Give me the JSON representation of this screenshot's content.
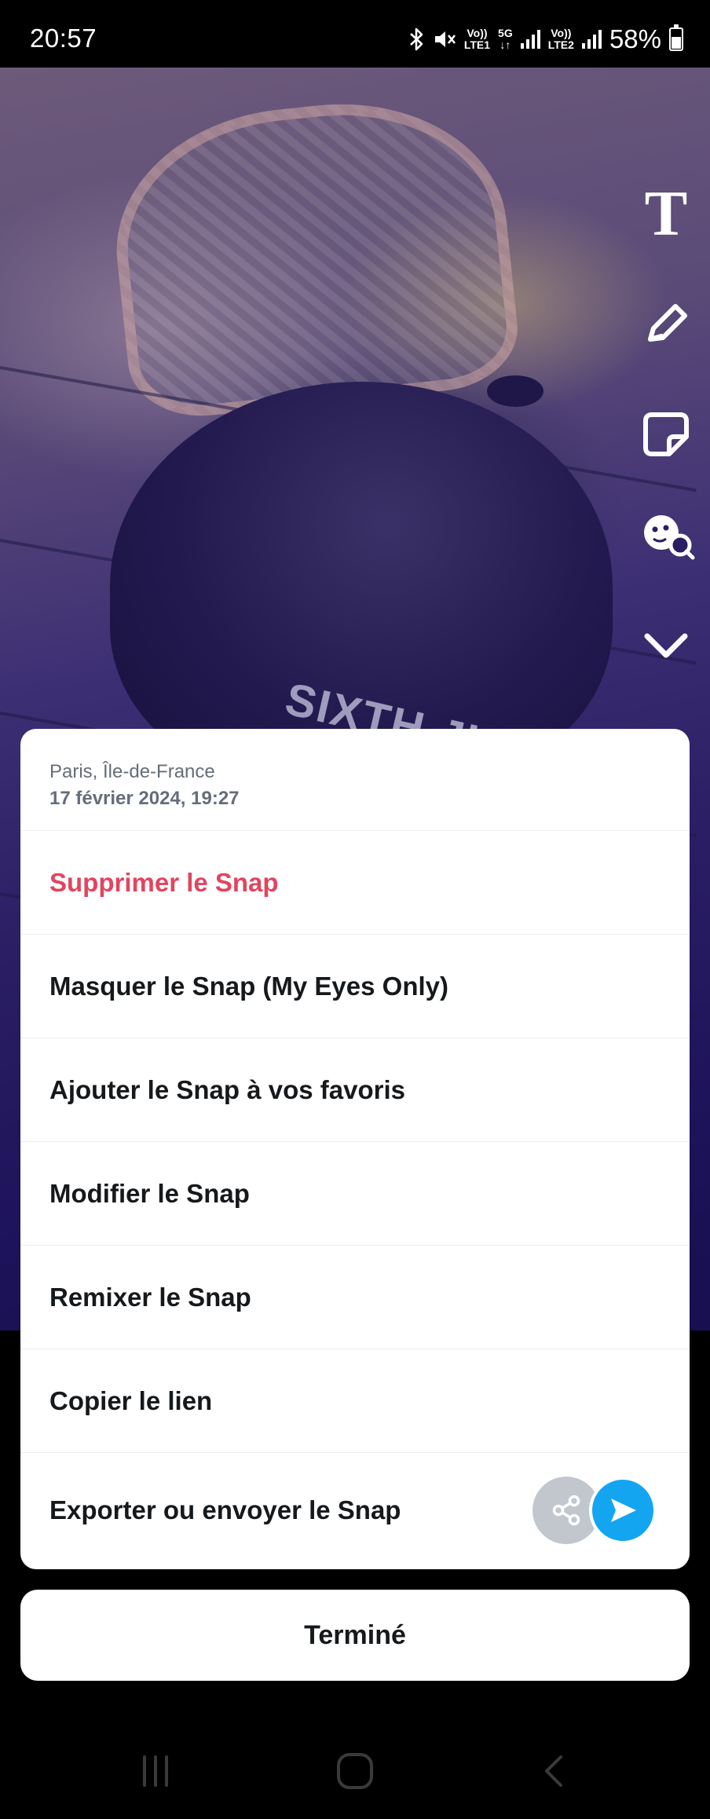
{
  "status_bar": {
    "time": "20:57",
    "network_1": "LTE1",
    "network_2": "LTE2",
    "net_type": "5G",
    "battery": "58%",
    "battery_level": 0.58
  },
  "photo": {
    "cap_text": "SIXTH JUNE"
  },
  "toolbar": {
    "text_tool": "T",
    "icons": [
      "text-icon",
      "pencil-icon",
      "sticker-icon",
      "lens-icon",
      "chevron-down-icon"
    ]
  },
  "sheet": {
    "location": "Paris, Île-de-France",
    "date": "17 février 2024, 19:27",
    "items": [
      {
        "label": "Supprimer le Snap",
        "color": "#e1455f"
      },
      {
        "label": "Masquer le Snap (My Eyes Only)"
      },
      {
        "label": "Ajouter le Snap à vos favoris"
      },
      {
        "label": "Modifier le Snap"
      },
      {
        "label": "Remixer le Snap"
      },
      {
        "label": "Copier le lien"
      },
      {
        "label": "Exporter ou envoyer le Snap"
      }
    ]
  },
  "done_label": "Terminé",
  "colors": {
    "accent_blue": "#14a5f1",
    "danger_red": "#e1455f",
    "share_gray": "#c2c7cd"
  }
}
